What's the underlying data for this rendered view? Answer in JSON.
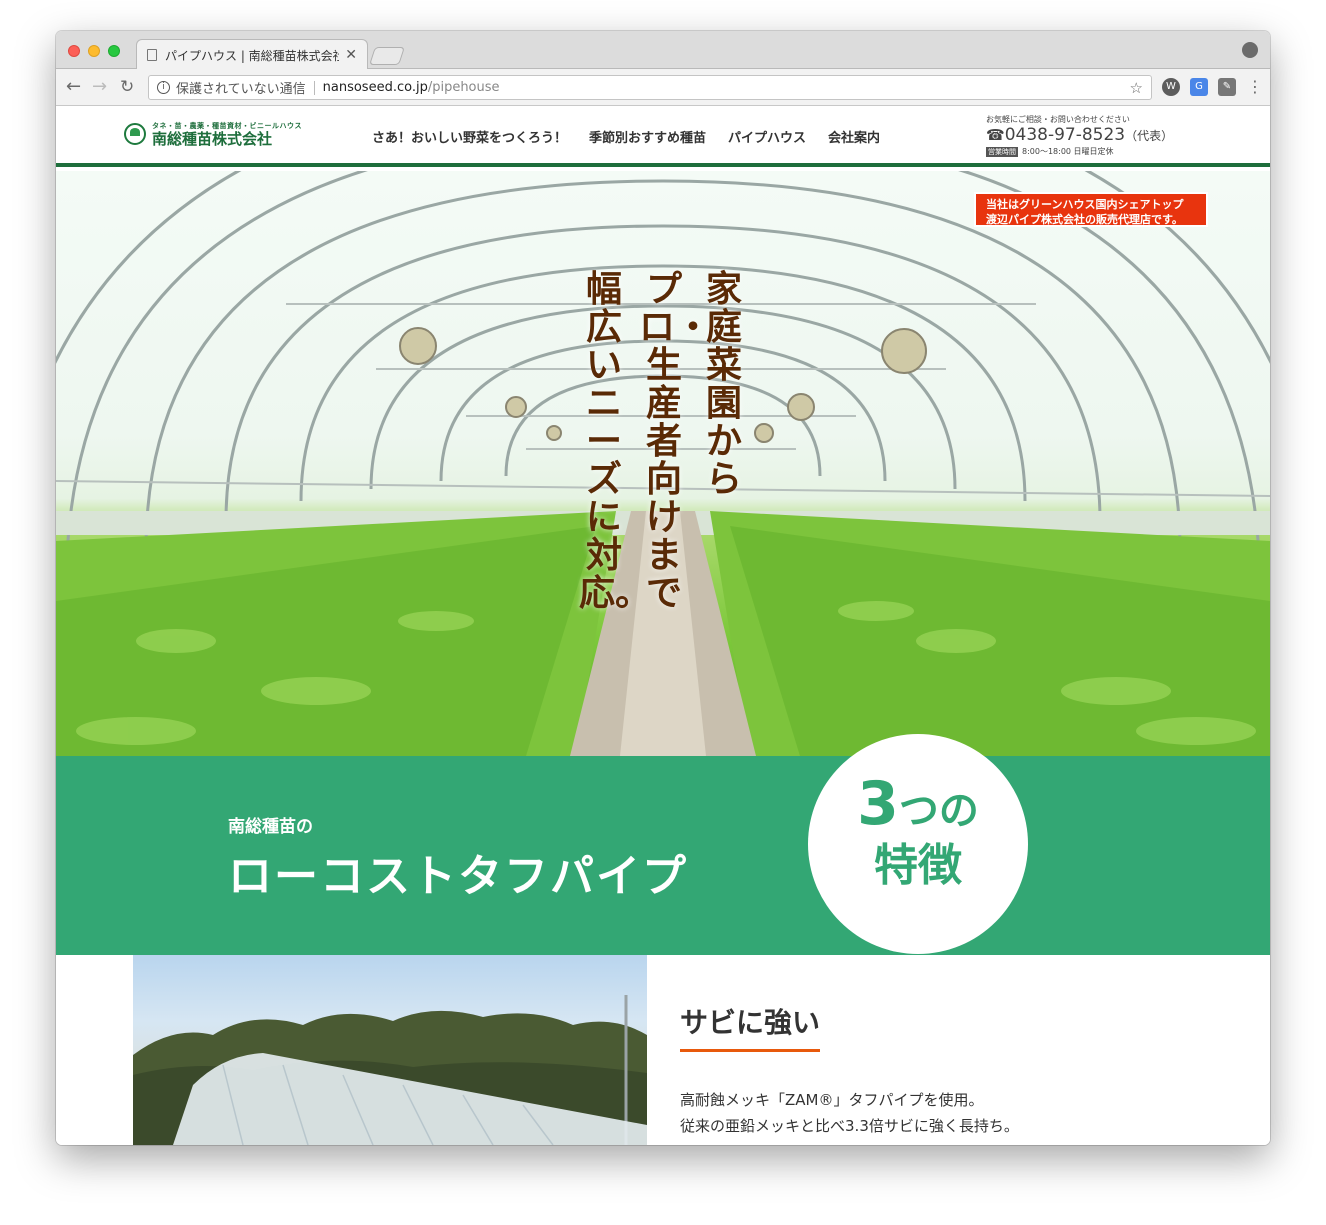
{
  "browser": {
    "tab_title": "パイプハウス | 南総種苗株式会社",
    "tab_close": "✕",
    "security_label": "保護されていない通信",
    "url_host": "nansoseed.co.jp",
    "url_path": "/pipehouse",
    "icons": [
      "back-arrow-icon",
      "forward-arrow-icon",
      "reload-icon",
      "info-icon",
      "star-icon",
      "wordpress-icon",
      "translate-icon",
      "extension-icon",
      "menu-icon"
    ]
  },
  "header": {
    "logo_sub": "タネ・苗・農薬・種苗資材・ビニールハウス",
    "logo_name": "南総種苗株式会社",
    "nav": [
      "さあ！おいしい野菜をつくろう！",
      "季節別おすすめ種苗",
      "パイプハウス",
      "会社案内"
    ],
    "contact_note": "お気軽にご相談・お問い合わせください",
    "phone": "0438-97-8523",
    "phone_note": "（代表）",
    "hours_label": "営業時間",
    "hours": "8:00〜18:00 日曜日定休"
  },
  "hero": {
    "notice_line1": "当社はグリーンハウス国内シェアトップ",
    "notice_line2": "渡辺パイプ株式会社の販売代理店です。",
    "copy_col1": "家庭菜園から",
    "copy_col2": "プロ・生産者向けまで",
    "copy_col3": "幅広いニーズに対応。"
  },
  "features": {
    "subtitle": "南総種苗の",
    "title": "ローコストタフパイプ",
    "circle_num": "3",
    "circle_num_suffix": "つの",
    "circle_word": "特徴"
  },
  "feature1": {
    "heading": "サビに強い",
    "text_line1": "高耐蝕メッキ「ZAM®」タフパイプを使用。",
    "text_line2": "従来の亜鉛メッキと比べ3.3倍サビに強く長持ち。"
  },
  "colors": {
    "brand_green": "#1e6e3c",
    "banner_green": "#33a774",
    "notice_red": "#e8340e",
    "heading_underline": "#e8590c",
    "hero_text": "#5a2a06"
  }
}
